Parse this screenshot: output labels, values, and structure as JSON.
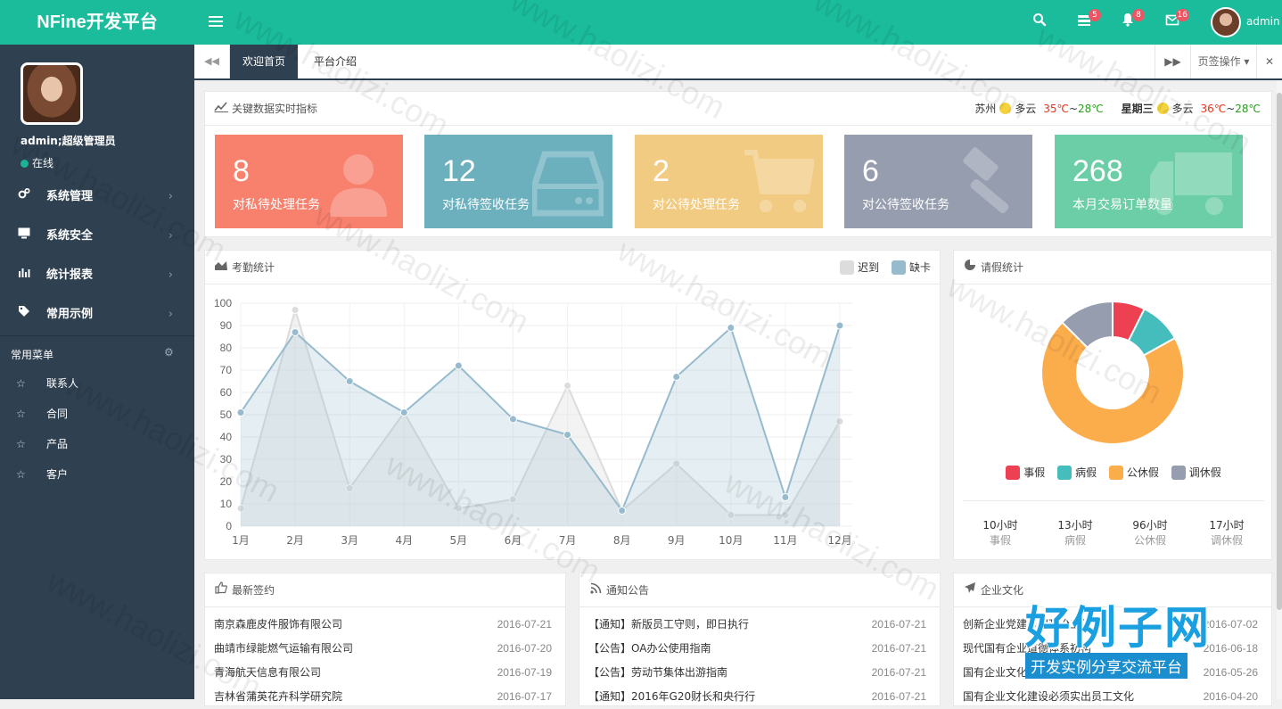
{
  "header": {
    "logo": "NFine开发平台",
    "badges": {
      "messages": "5",
      "alerts": "8",
      "mail": "16"
    },
    "user": "admin"
  },
  "sidebar": {
    "user_name": "admin;超级管理员",
    "status": "在线",
    "nav": [
      {
        "label": "系统管理",
        "icon": "gears-icon"
      },
      {
        "label": "系统安全",
        "icon": "monitor-icon"
      },
      {
        "label": "统计报表",
        "icon": "bar-chart-icon"
      },
      {
        "label": "常用示例",
        "icon": "tags-icon"
      }
    ],
    "section_title": "常用菜单",
    "favorites": [
      "联系人",
      "合同",
      "产品",
      "客户"
    ]
  },
  "tabs": {
    "items": [
      "欢迎首页",
      "平台介绍"
    ],
    "active": 0,
    "ops_label": "页签操作"
  },
  "kpi_panel": {
    "title": "关键数据实时指标",
    "weather": {
      "city": "苏州",
      "day1": {
        "cond": "多云",
        "hi": "35℃",
        "lo": "28℃"
      },
      "weekday": "星期三",
      "day2": {
        "cond": "多云",
        "hi": "36℃",
        "lo": "28℃"
      }
    },
    "cards": [
      {
        "value": "8",
        "label": "对私待处理任务",
        "color": "#f8816e",
        "icon": "user-icon"
      },
      {
        "value": "12",
        "label": "对私待签收任务",
        "color": "#6cb0be",
        "icon": "hdd-icon"
      },
      {
        "value": "2",
        "label": "对公待处理任务",
        "color": "#f2cb82",
        "icon": "cart-icon"
      },
      {
        "value": "6",
        "label": "对公待签收任务",
        "color": "#959daf",
        "icon": "gavel-icon"
      },
      {
        "value": "268",
        "label": "本月交易订单数量",
        "color": "#6ccea6",
        "icon": "truck-icon"
      }
    ]
  },
  "attendance": {
    "title": "考勤统计",
    "chart_data": {
      "type": "area",
      "categories": [
        "1月",
        "2月",
        "3月",
        "4月",
        "5月",
        "6月",
        "7月",
        "8月",
        "9月",
        "10月",
        "11月",
        "12月"
      ],
      "ylim": [
        0,
        100
      ],
      "yticks": [
        "0",
        "10",
        "20",
        "30",
        "40",
        "50",
        "60",
        "70",
        "80",
        "90",
        "100"
      ],
      "grid": true,
      "legend": "top-right",
      "series": [
        {
          "name": "迟到",
          "color": "#dcdcdc",
          "values": [
            8,
            97,
            17,
            51,
            8,
            12,
            63,
            7,
            28,
            5,
            5,
            47
          ]
        },
        {
          "name": "缺卡",
          "color": "#97bbcd",
          "values": [
            51,
            87,
            65,
            51,
            72,
            48,
            41,
            7,
            67,
            89,
            13,
            90
          ]
        }
      ]
    }
  },
  "leave": {
    "title": "请假统计",
    "chart_data": {
      "type": "pie",
      "labels": [
        "事假",
        "病假",
        "公休假",
        "调休假"
      ],
      "values": [
        10,
        13,
        96,
        17
      ],
      "colors": [
        "#ed4152",
        "#45bdbc",
        "#fbad4c",
        "#959daf"
      ]
    },
    "summary": [
      {
        "value": "10小时",
        "label": "事假"
      },
      {
        "value": "13小时",
        "label": "病假"
      },
      {
        "value": "96小时",
        "label": "公休假"
      },
      {
        "value": "17小时",
        "label": "调休假"
      }
    ]
  },
  "contracts": {
    "title": "最新签约",
    "rows": [
      {
        "text": "南京森鹿皮件服饰有限公司",
        "date": "2016-07-21"
      },
      {
        "text": "曲靖市绿能燃气运输有限公司",
        "date": "2016-07-20"
      },
      {
        "text": "青海航天信息有限公司",
        "date": "2016-07-19"
      },
      {
        "text": "吉林省蒲英花卉科学研究院",
        "date": "2016-07-17"
      }
    ]
  },
  "notices": {
    "title": "通知公告",
    "rows": [
      {
        "text": "【通知】新版员工守则，即日执行",
        "date": "2016-07-21"
      },
      {
        "text": "【公告】OA办公使用指南",
        "date": "2016-07-21"
      },
      {
        "text": "【公告】劳动节集体出游指南",
        "date": "2016-07-21"
      },
      {
        "text": "【通知】2016年G20财长和央行行",
        "date": "2016-07-21"
      }
    ]
  },
  "culture": {
    "title": "企业文化",
    "rows": [
      {
        "text": "创新企业党建思想政治工作",
        "date": "2016-07-02"
      },
      {
        "text": "现代国有企业道德体系初构",
        "date": "2016-06-18"
      },
      {
        "text": "国有企业文化",
        "date": "2016-05-26"
      },
      {
        "text": "国有企业文化建设必须实出员工文化",
        "date": "2016-04-20"
      }
    ]
  },
  "watermark": {
    "text": "www.haolizi.com",
    "brand_big": "好例子网",
    "brand_small": "开发实例分享交流平台"
  }
}
